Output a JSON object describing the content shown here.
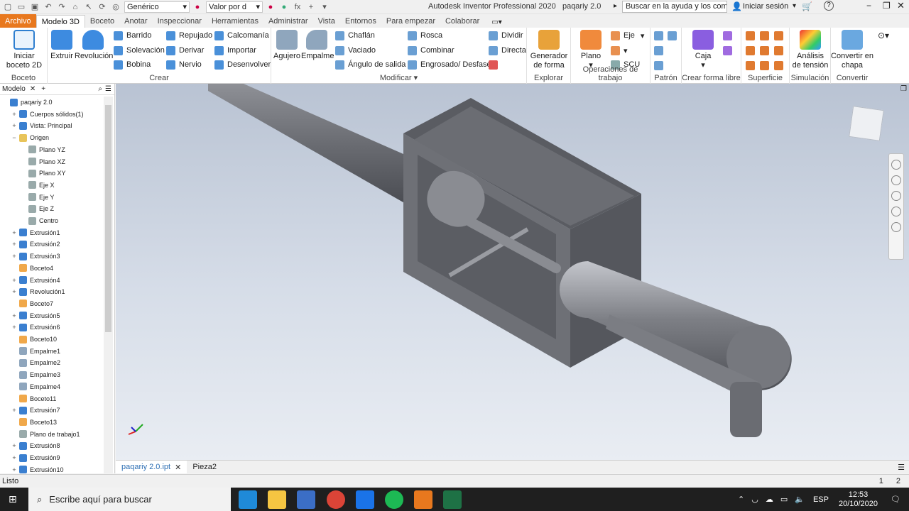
{
  "window": {
    "app_title": "Autodesk Inventor Professional 2020",
    "doc_title": "paqariy 2.0"
  },
  "qat": {
    "material": "Genérico",
    "appearance": "Valor por d",
    "fx": "fx"
  },
  "help": {
    "search_placeholder": "Buscar en la ayuda y los comandos",
    "signin": "Iniciar sesión",
    "help_q": "?"
  },
  "tabs": [
    "Archivo",
    "Modelo 3D",
    "Boceto",
    "Anotar",
    "Inspeccionar",
    "Herramientas",
    "Administrar",
    "Vista",
    "Entornos",
    "Para empezar",
    "Colaborar"
  ],
  "ribbon": {
    "boceto": {
      "label": "Boceto",
      "start": "Iniciar",
      "start2": "boceto 2D"
    },
    "crear": {
      "label": "Crear",
      "extruir": "Extruir",
      "revolucion": "Revolución",
      "barrido": "Barrido",
      "solevacion": "Solevación",
      "bobina": "Bobina",
      "repujado": "Repujado",
      "derivar": "Derivar",
      "nervio": "Nervio",
      "calcomania": "Calcomanía",
      "importar": "Importar",
      "desenvolver": "Desenvolver"
    },
    "modificar": {
      "label": "Modificar",
      "agujero": "Agujero",
      "empalme": "Empalme",
      "chaflan": "Chaflán",
      "vaciado": "Vaciado",
      "angulo": "Ángulo de salida",
      "rosca": "Rosca",
      "combinar": "Combinar",
      "engrosado": "Engrosado/ Desfase",
      "dividir": "Dividir",
      "directa": "Directa"
    },
    "explorar": {
      "label": "Explorar",
      "gen": "Generador",
      "gen2": "de forma"
    },
    "ops": {
      "label": "Operaciones de trabajo",
      "plano": "Plano",
      "eje": "Eje",
      "scu": "SCU"
    },
    "patron": {
      "label": "Patrón"
    },
    "libre": {
      "label": "Crear forma libre",
      "caja": "Caja"
    },
    "superficie": {
      "label": "Superficie"
    },
    "sim": {
      "label": "Simulación",
      "an": "Análisis",
      "an2": "de tensión"
    },
    "conv": {
      "label": "Convertir",
      "c": "Convertir en",
      "c2": "chapa"
    }
  },
  "browser": {
    "tab": "Modelo",
    "items": [
      {
        "label": "paqariy 2.0",
        "lvl": 0,
        "exp": ""
      },
      {
        "label": "Cuerpos sólidos(1)",
        "lvl": 1,
        "exp": "+"
      },
      {
        "label": "Vista: Principal",
        "lvl": 1,
        "exp": "+"
      },
      {
        "label": "Origen",
        "lvl": 1,
        "exp": "−"
      },
      {
        "label": "Plano YZ",
        "lvl": 2,
        "exp": ""
      },
      {
        "label": "Plano XZ",
        "lvl": 2,
        "exp": ""
      },
      {
        "label": "Plano XY",
        "lvl": 2,
        "exp": ""
      },
      {
        "label": "Eje X",
        "lvl": 2,
        "exp": ""
      },
      {
        "label": "Eje Y",
        "lvl": 2,
        "exp": ""
      },
      {
        "label": "Eje Z",
        "lvl": 2,
        "exp": ""
      },
      {
        "label": "Centro",
        "lvl": 2,
        "exp": ""
      },
      {
        "label": "Extrusión1",
        "lvl": 1,
        "exp": "+"
      },
      {
        "label": "Extrusión2",
        "lvl": 1,
        "exp": "+"
      },
      {
        "label": "Extrusión3",
        "lvl": 1,
        "exp": "+"
      },
      {
        "label": "Boceto4",
        "lvl": 1,
        "exp": ""
      },
      {
        "label": "Extrusión4",
        "lvl": 1,
        "exp": "+"
      },
      {
        "label": "Revolución1",
        "lvl": 1,
        "exp": "+"
      },
      {
        "label": "Boceto7",
        "lvl": 1,
        "exp": ""
      },
      {
        "label": "Extrusión5",
        "lvl": 1,
        "exp": "+"
      },
      {
        "label": "Extrusión6",
        "lvl": 1,
        "exp": "+"
      },
      {
        "label": "Boceto10",
        "lvl": 1,
        "exp": ""
      },
      {
        "label": "Empalme1",
        "lvl": 1,
        "exp": ""
      },
      {
        "label": "Empalme2",
        "lvl": 1,
        "exp": ""
      },
      {
        "label": "Empalme3",
        "lvl": 1,
        "exp": ""
      },
      {
        "label": "Empalme4",
        "lvl": 1,
        "exp": ""
      },
      {
        "label": "Boceto11",
        "lvl": 1,
        "exp": ""
      },
      {
        "label": "Extrusión7",
        "lvl": 1,
        "exp": "+"
      },
      {
        "label": "Boceto13",
        "lvl": 1,
        "exp": ""
      },
      {
        "label": "Plano de trabajo1",
        "lvl": 1,
        "exp": ""
      },
      {
        "label": "Extrusión8",
        "lvl": 1,
        "exp": "+"
      },
      {
        "label": "Extrusión9",
        "lvl": 1,
        "exp": "+"
      },
      {
        "label": "Extrusión10",
        "lvl": 1,
        "exp": "+"
      }
    ]
  },
  "doc_tabs": [
    "paqariy 2.0.ipt",
    "Pieza2"
  ],
  "status": {
    "text": "Listo",
    "page1": "1",
    "page2": "2"
  },
  "taskbar": {
    "search": "Escribe aquí para buscar",
    "lang": "ESP",
    "time": "12:53",
    "date": "20/10/2020"
  },
  "colors": {
    "accent": "#e8781e",
    "link": "#2d6fb4"
  }
}
